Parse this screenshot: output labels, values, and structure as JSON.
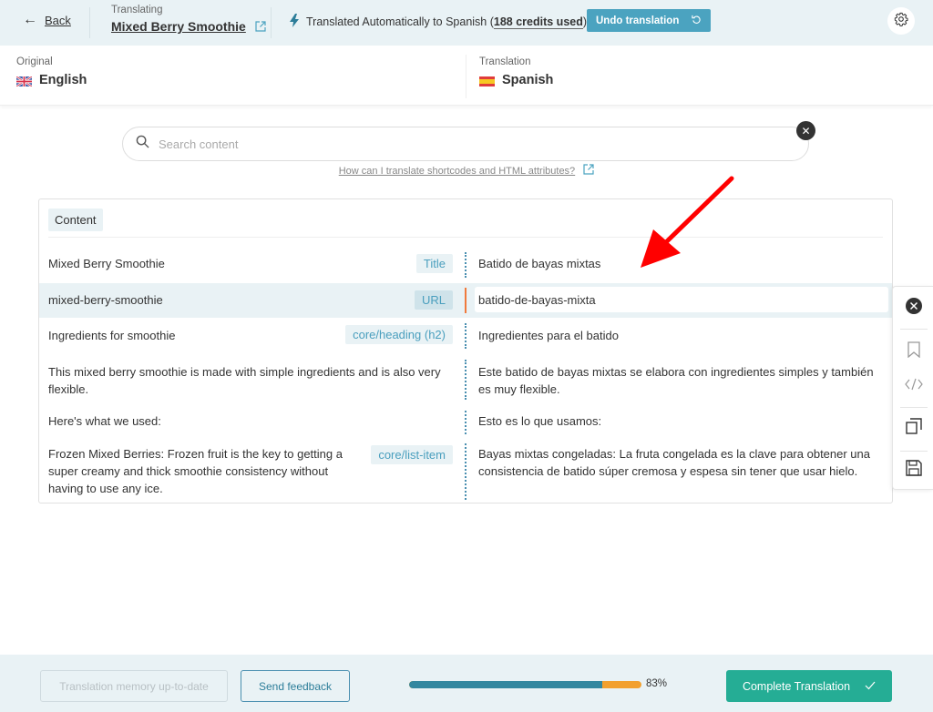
{
  "header": {
    "back_label": "Back",
    "translating_label": "Translating",
    "post_title": "Mixed Berry Smoothie",
    "auto_text_prefix": "Translated Automatically to Spanish (",
    "credits": "188 credits used",
    "auto_text_suffix": ")",
    "undo_label": "Undo translation",
    "icons": {
      "back": "arrow-left-icon",
      "external": "external-link-icon",
      "bolt": "lightning-icon",
      "undo": "undo-icon",
      "settings": "gear-icon"
    }
  },
  "languages": {
    "original_label": "Original",
    "original_language": "English",
    "translation_label": "Translation",
    "translation_language": "Spanish"
  },
  "search": {
    "placeholder": "Search content",
    "help_link": "How can I translate shortcodes and HTML attributes?"
  },
  "content": {
    "section_label": "Content",
    "rows": [
      {
        "source": "Mixed Berry Smoothie",
        "type": "Title",
        "target": "Batido de bayas mixtas"
      },
      {
        "source": "mixed-berry-smoothie",
        "type": "URL",
        "target": "batido-de-bayas-mixta",
        "active": true
      },
      {
        "source": "Ingredients for smoothie",
        "type": "core/heading (h2)",
        "target": "Ingredientes para el batido"
      },
      {
        "source": "This mixed berry smoothie is made with simple ingredients and is also very flexible.",
        "type": "",
        "target": "Este batido de bayas mixtas se elabora con ingredientes simples y también es muy flexible."
      },
      {
        "source": "Here's what we used:",
        "type": "",
        "target": "Esto es lo que usamos:"
      },
      {
        "source": "Frozen Mixed Berries: Frozen fruit is the key to getting a super creamy and thick smoothie consistency without having to use any ice.",
        "type": "core/list-item",
        "target": "Bayas mixtas congeladas: La fruta congelada es la clave para obtener una consistencia de batido súper cremosa y espesa sin tener que usar hielo."
      }
    ]
  },
  "side_panel": {
    "icons": [
      "close-icon",
      "bookmark-icon",
      "code-icon",
      "copy-icon",
      "save-icon"
    ]
  },
  "footer": {
    "memory_button": "Translation memory up-to-date",
    "feedback_button": "Send feedback",
    "progress_percent": 83,
    "progress_label": "83%",
    "complete_button": "Complete Translation"
  },
  "colors": {
    "accent": "#4ba3c0",
    "progress_done": "#33879f",
    "progress_rest": "#f2a02e",
    "complete": "#25ad95",
    "active_marker": "#f07a3c",
    "annotation_arrow": "#ff0000"
  }
}
